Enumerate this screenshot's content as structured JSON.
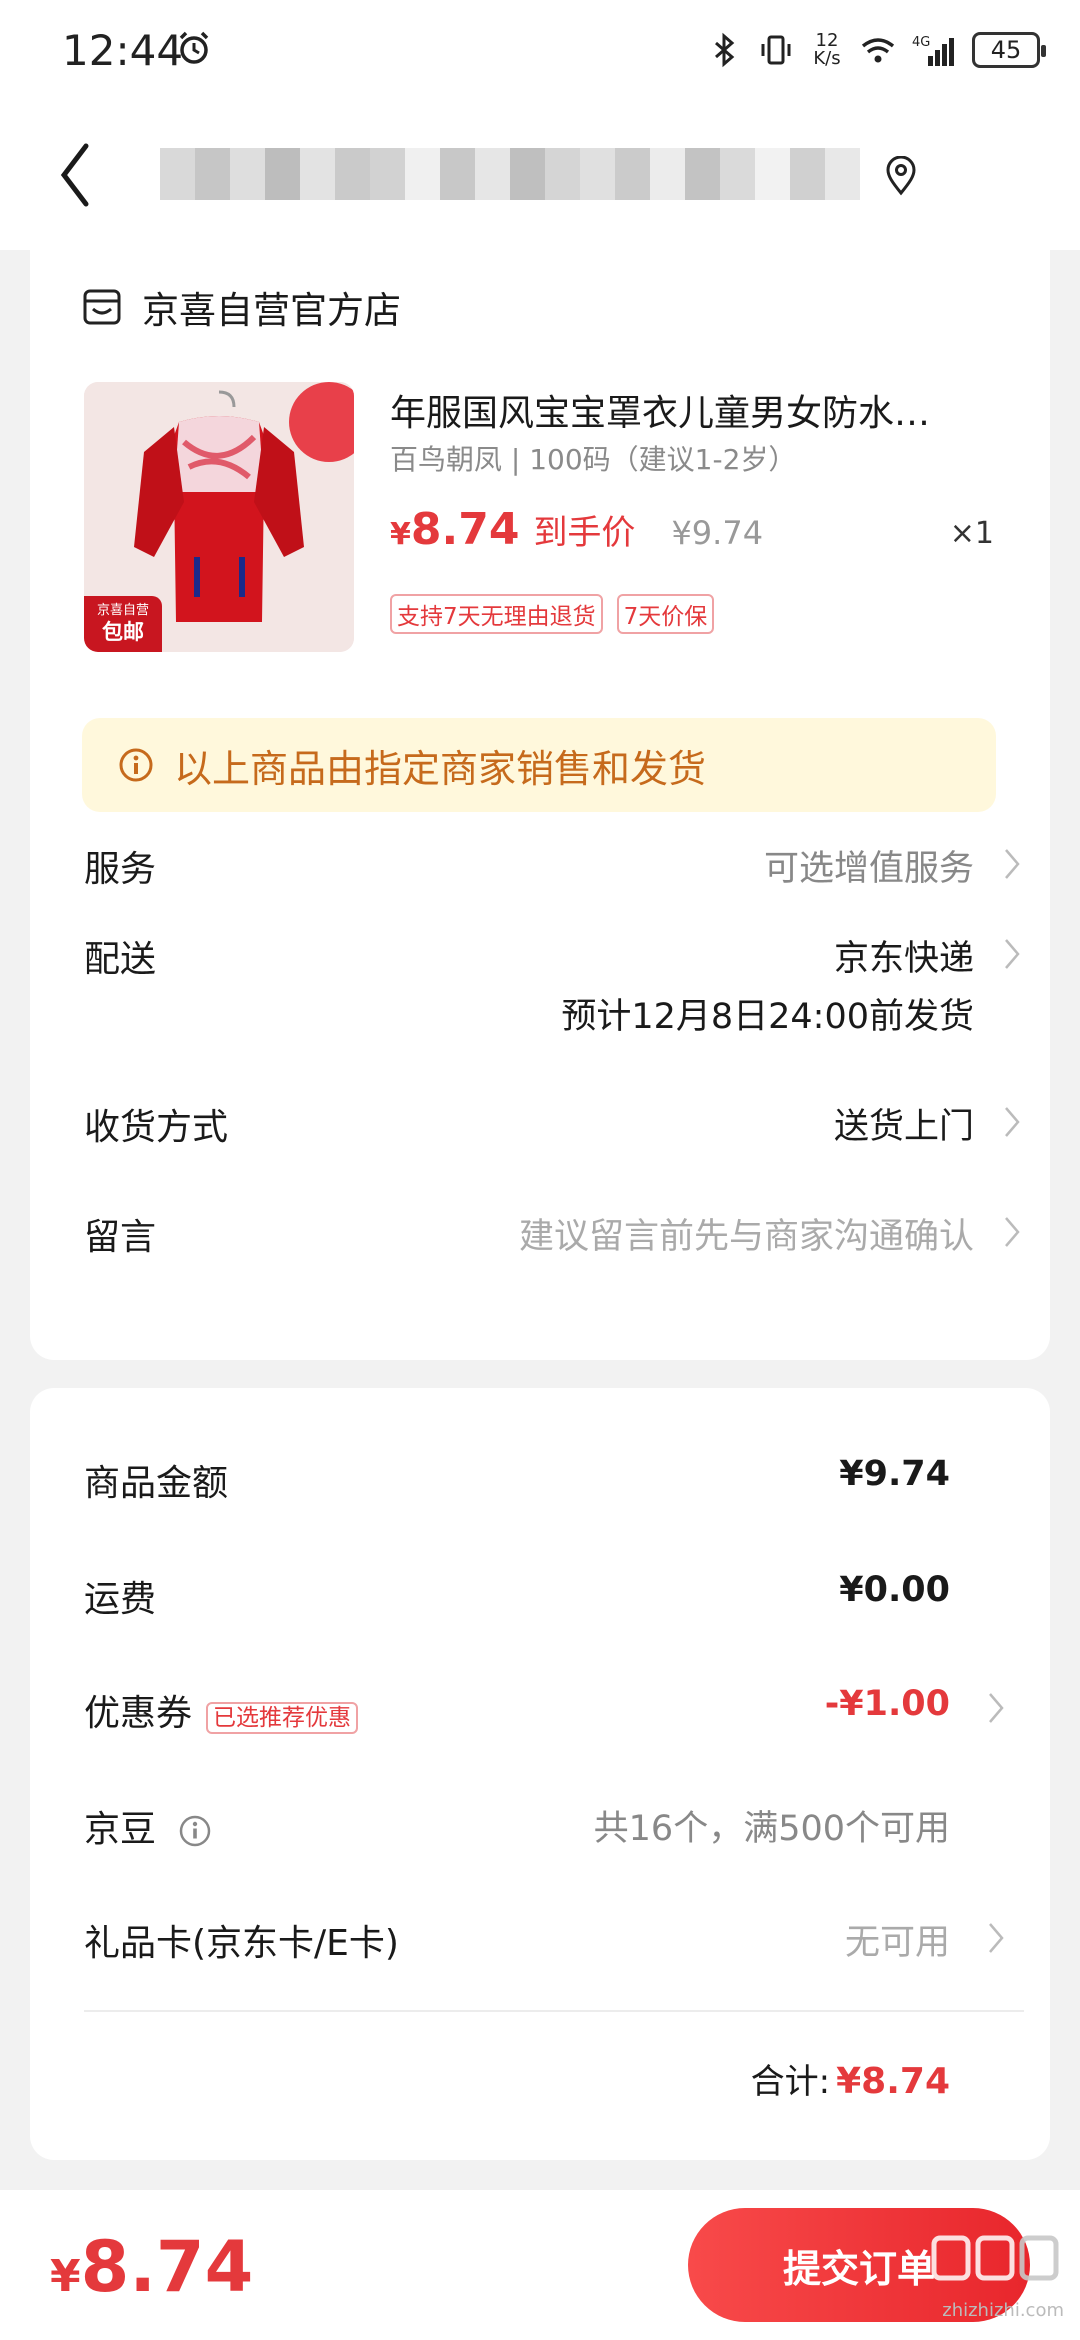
{
  "status_bar": {
    "time": "12:44",
    "net_speed_top": "12",
    "net_speed_bottom": "K/s",
    "network": "4G",
    "battery": "45"
  },
  "header": {
    "icons": [
      "back-icon",
      "location-icon"
    ]
  },
  "shop": {
    "name": "京喜自营官方店",
    "icon": "shop-icon"
  },
  "product": {
    "title": "年服国风宝宝罩衣儿童男女防水…",
    "spec": "百鸟朝凤 | 100码（建议1-2岁）",
    "price_symbol": "¥",
    "price_now": "8.74",
    "price_tag": "到手价",
    "price_old": "¥9.74",
    "quantity": "×1",
    "tags": [
      "支持7天无理由退货",
      "7天价保"
    ],
    "badge_top": "京喜自营",
    "badge_bottom": "包邮"
  },
  "notice": {
    "text": "以上商品由指定商家销售和发货"
  },
  "rows": {
    "service": {
      "label": "服务",
      "value": "可选增值服务"
    },
    "delivery": {
      "label": "配送",
      "value": "京东快递",
      "sub": "预计12月8日24:00前发货"
    },
    "receive": {
      "label": "收货方式",
      "value": "送货上门"
    },
    "message": {
      "label": "留言",
      "placeholder": "建议留言前先与商家沟通确认"
    }
  },
  "amounts": {
    "goods": {
      "label": "商品金额",
      "value": "¥9.74"
    },
    "shipping": {
      "label": "运费",
      "value": "¥0.00"
    },
    "coupon": {
      "label": "优惠券",
      "tag": "已选推荐优惠",
      "value": "-¥1.00"
    },
    "beans": {
      "label": "京豆",
      "value": "共16个，满500个可用"
    },
    "giftcard": {
      "label": "礼品卡(京东卡/E卡)",
      "value": "无可用"
    },
    "total_label": "合计:",
    "total_value": "¥8.74"
  },
  "bottom": {
    "price_symbol": "¥",
    "price": "8.74",
    "submit_label": "提交订单"
  },
  "watermark": "zhizhizhi.com",
  "colors": {
    "accent": "#e4393c",
    "notice_bg": "#fff8dc",
    "notice_text": "#c66a1c"
  }
}
